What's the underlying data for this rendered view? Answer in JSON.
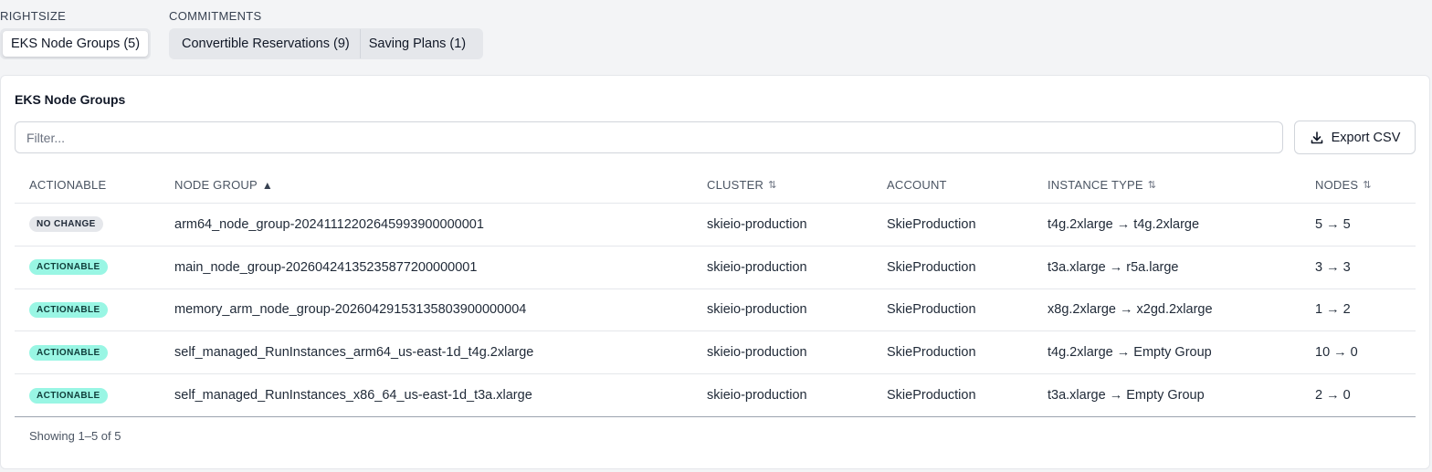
{
  "rightsize": {
    "label": "RIGHTSIZE",
    "tabs": [
      {
        "label": "EKS Node Groups (5)",
        "active": true
      }
    ]
  },
  "commitments": {
    "label": "COMMITMENTS",
    "tabs": [
      {
        "label": "Convertible Reservations (9)"
      },
      {
        "label": "Saving Plans (1)"
      }
    ]
  },
  "card": {
    "title": "EKS Node Groups",
    "filter_placeholder": "Filter...",
    "export_label": "Export CSV",
    "export_icon": "download-icon"
  },
  "table": {
    "headers": {
      "actionable": "ACTIONABLE",
      "node_group": "NODE GROUP",
      "cluster": "CLUSTER",
      "account": "ACCOUNT",
      "instance_type": "INSTANCE TYPE",
      "nodes": "NODES"
    },
    "sort": {
      "column": "node_group",
      "direction": "ascending",
      "asc_glyph": "▲",
      "unsorted_glyph": "⇅"
    },
    "rows": [
      {
        "status": "NO CHANGE",
        "node_group": "arm64_node_group-20241112202645993900000001",
        "cluster": "skieio-production",
        "account": "SkieProduction",
        "instance_type": "t4g.2xlarge → t4g.2xlarge",
        "nodes": "5 → 5"
      },
      {
        "status": "ACTIONABLE",
        "node_group": "main_node_group-20260424135235877200000001",
        "cluster": "skieio-production",
        "account": "SkieProduction",
        "instance_type": "t3a.xlarge → r5a.large",
        "nodes": "3 → 3"
      },
      {
        "status": "ACTIONABLE",
        "node_group": "memory_arm_node_group-20260429153135803900000004",
        "cluster": "skieio-production",
        "account": "SkieProduction",
        "instance_type": "x8g.2xlarge → x2gd.2xlarge",
        "nodes": "1 → 2"
      },
      {
        "status": "ACTIONABLE",
        "node_group": "self_managed_RunInstances_arm64_us-east-1d_t4g.2xlarge",
        "cluster": "skieio-production",
        "account": "SkieProduction",
        "instance_type": "t4g.2xlarge → Empty Group",
        "nodes": "10 → 0"
      },
      {
        "status": "ACTIONABLE",
        "node_group": "self_managed_RunInstances_x86_64_us-east-1d_t3a.xlarge",
        "cluster": "skieio-production",
        "account": "SkieProduction",
        "instance_type": "t3a.xlarge → Empty Group",
        "nodes": "2 → 0"
      }
    ],
    "footer": "Showing 1–5 of 5"
  },
  "colors": {
    "badge_actionable": "#99f6e4",
    "badge_nochange": "#e5e7eb",
    "background": "#f3f4f6"
  }
}
